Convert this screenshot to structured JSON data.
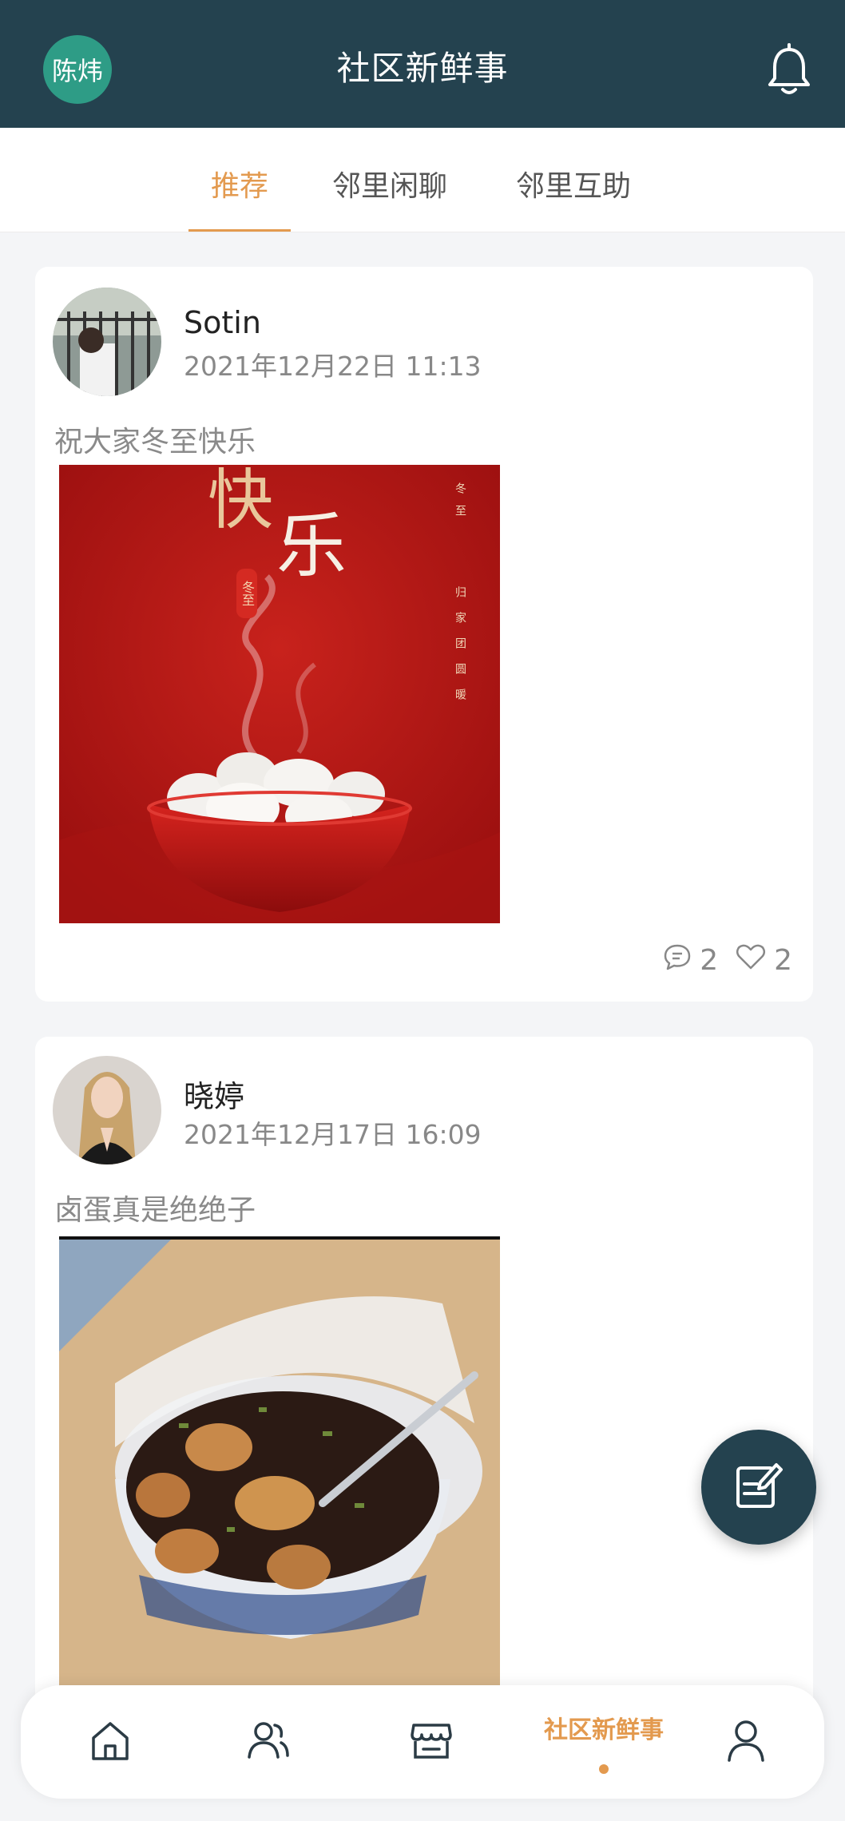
{
  "header": {
    "user_badge": "陈炜",
    "title": "社区新鲜事",
    "icon": "bell-icon"
  },
  "tabs": [
    {
      "label": "推荐",
      "active": true
    },
    {
      "label": "邻里闲聊",
      "active": false
    },
    {
      "label": "邻里互助",
      "active": false
    }
  ],
  "posts": [
    {
      "author": "Sotin",
      "time": "2021年12月22日 11:13",
      "text": "祝大家冬至快乐",
      "image_caption_main_1": "快",
      "image_caption_main_2": "乐",
      "image_side_1": "冬至",
      "image_side_2": "归家团圆暖",
      "image_seal": "冬至",
      "comments": "2",
      "likes": "2"
    },
    {
      "author": "晓婷",
      "time": "2021年12月17日 16:09",
      "text": "卤蛋真是绝绝子"
    }
  ],
  "bottom_nav": {
    "items": [
      {
        "icon": "home-icon"
      },
      {
        "icon": "users-icon"
      },
      {
        "icon": "store-icon"
      },
      {
        "label": "社区新鲜事",
        "active": true
      },
      {
        "icon": "person-icon"
      }
    ]
  },
  "colors": {
    "header_bg": "#24424f",
    "accent": "#e39a4f",
    "badge": "#2e9c86"
  }
}
